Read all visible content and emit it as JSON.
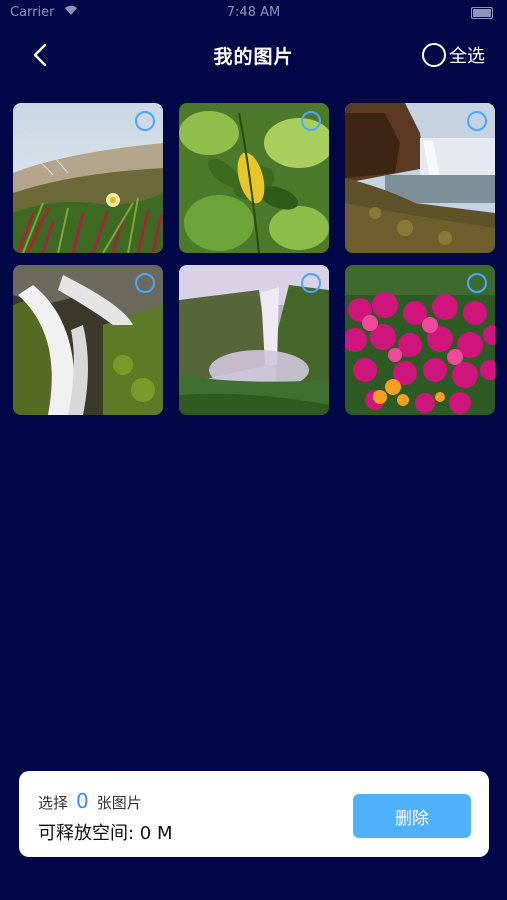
{
  "status": {
    "carrier": "Carrier",
    "time": "7:48 AM"
  },
  "nav": {
    "title": "我的图片",
    "select_all": "全选"
  },
  "photos": [
    {
      "subject": "ice plant flowers by the sea",
      "selected": false
    },
    {
      "subject": "green leaves with yellow leaf",
      "selected": false
    },
    {
      "subject": "waterfall cliff and lake",
      "selected": false
    },
    {
      "subject": "mossy waterfall",
      "selected": false
    },
    {
      "subject": "misty waterfall valley",
      "selected": false
    },
    {
      "subject": "magenta daisy flowers",
      "selected": false
    }
  ],
  "panel": {
    "select_prefix": "选择",
    "select_count": "0",
    "select_suffix": "张图片",
    "space_label": "可释放空间: 0 M",
    "delete_label": "删除"
  },
  "colors": {
    "background": "#020847",
    "accent": "#4aa8ff",
    "delete_button": "#4fb0fb"
  }
}
